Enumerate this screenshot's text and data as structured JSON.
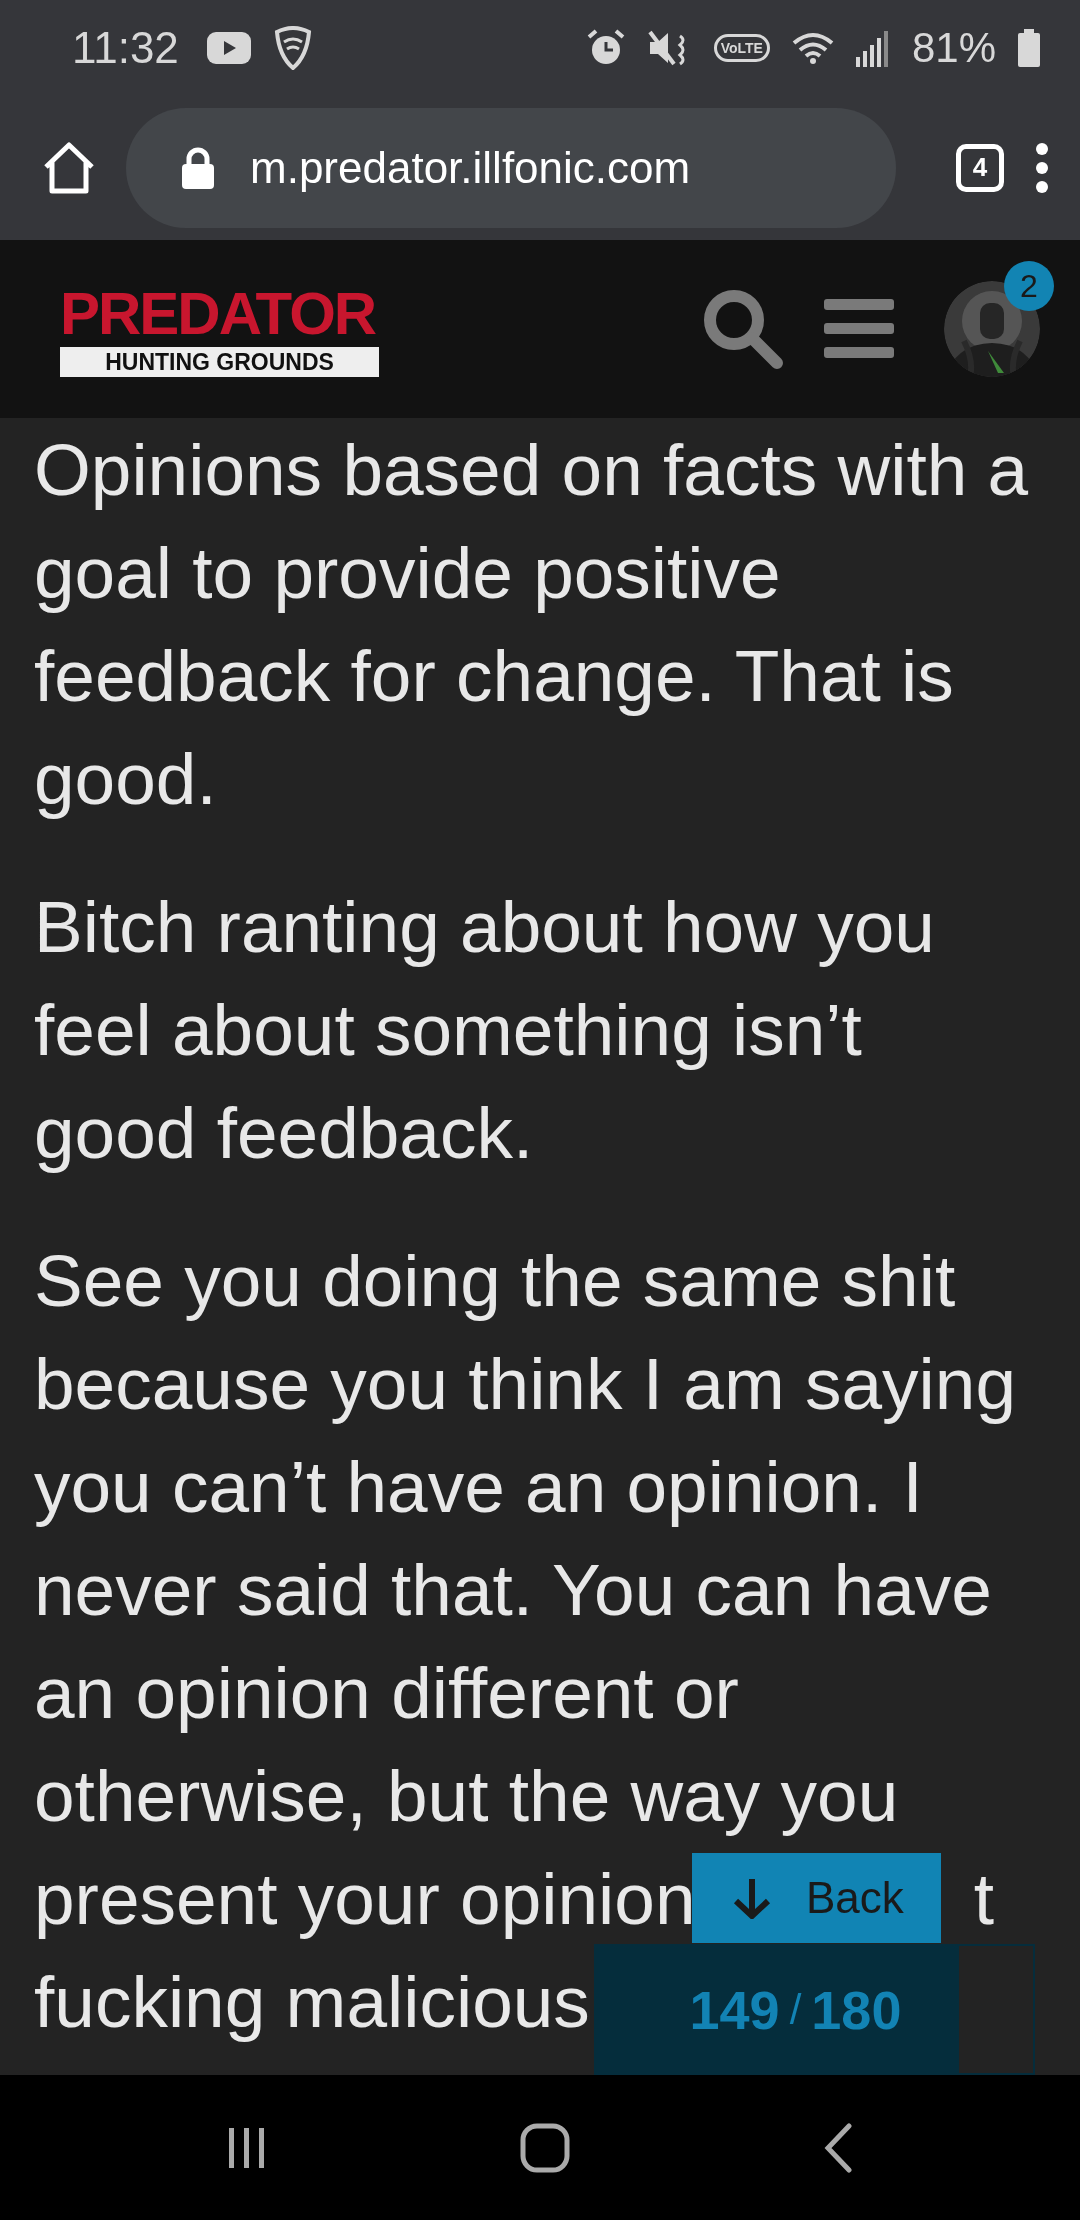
{
  "status_bar": {
    "time": "11:32",
    "volte": "VoLTE",
    "battery": "81%"
  },
  "browser": {
    "url": "m.predator.illfonic.com",
    "tab_count": "4"
  },
  "site_header": {
    "logo_title": "PREDATOR",
    "logo_subtitle": "HUNTING GROUNDS",
    "notification_count": "2"
  },
  "post": {
    "paragraphs": [
      {
        "lines": [
          "Opinions based on facts with a",
          "goal to provide positive",
          "feedback for change. That is",
          "good."
        ]
      },
      {
        "lines": [
          "Bitch ranting about how you",
          "feel about something isn’t",
          "good feedback."
        ]
      },
      {
        "lines": [
          "See you doing the same shit",
          "because you think I am saying",
          "you can’t have an opinion. I",
          "never said that. You can have",
          "an opinion different or",
          "otherwise, but the way you"
        ],
        "fragments": [
          "present your opinion",
          "t",
          "fucking malicious"
        ]
      }
    ]
  },
  "jump_button": {
    "label": "Back"
  },
  "page_counter": {
    "current": "149",
    "separator": "/",
    "total": "180"
  }
}
